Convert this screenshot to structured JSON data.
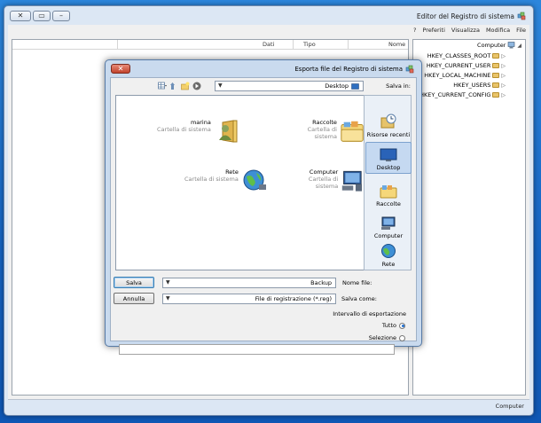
{
  "main_window": {
    "title": "Editor del Registro di sistema",
    "menu": [
      "File",
      "Modifica",
      "Visualizza",
      "Preferiti",
      "?"
    ],
    "list_columns": [
      "Nome",
      "Tipo",
      "Dati"
    ],
    "tree": {
      "root": "Computer",
      "keys": [
        "HKEY_CLASSES_ROOT",
        "HKEY_CURRENT_USER",
        "HKEY_LOCAL_MACHINE",
        "HKEY_USERS",
        "HKEY_CURRENT_CONFIG"
      ]
    },
    "status": "Computer"
  },
  "dialog": {
    "title": "Esporta file del Registro di sistema",
    "save_in_label": "Salva in:",
    "save_in_value": "Desktop",
    "files": [
      {
        "name": "Raccolte",
        "type": "Cartella di sistema",
        "icon": "library-icon"
      },
      {
        "name": "marina",
        "type": "Cartella di sistema",
        "icon": "user-folder-icon"
      },
      {
        "name": "Computer",
        "type": "Cartella di sistema",
        "icon": "computer-icon"
      },
      {
        "name": "Rete",
        "type": "Cartella di sistema",
        "icon": "network-icon"
      }
    ],
    "places": [
      {
        "label": "Risorse recenti",
        "icon": "recent-places-icon"
      },
      {
        "label": "Desktop",
        "icon": "desktop-icon"
      },
      {
        "label": "Raccolte",
        "icon": "library-icon"
      },
      {
        "label": "Computer",
        "icon": "computer-icon"
      },
      {
        "label": "Rete",
        "icon": "network-icon"
      }
    ],
    "selected_place": "Desktop",
    "file_name_label": "Nome file:",
    "file_name_value": "Backup",
    "save_as_label": "Salva come:",
    "save_as_value": "File di registrazione (*.reg)",
    "save_button": "Salva",
    "cancel_button": "Annulla",
    "export_range_label": "Intervallo di esportazione",
    "range_all": "Tutto",
    "range_selected": "Selezione",
    "range_selected_value": "all"
  }
}
